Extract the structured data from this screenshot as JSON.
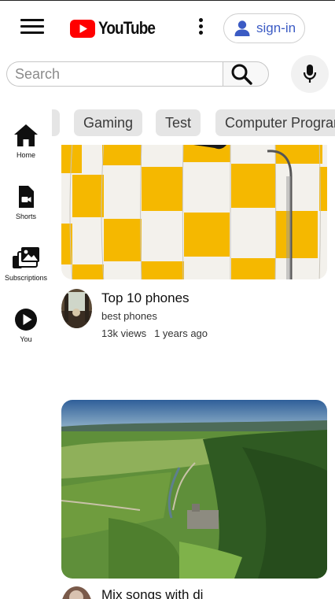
{
  "header": {
    "logo_text": "YouTube",
    "signin_label": "sign-in"
  },
  "search": {
    "placeholder": "Search",
    "value": ""
  },
  "sidebar": {
    "items": [
      {
        "label": "Home",
        "icon": "home-icon"
      },
      {
        "label": "Shorts",
        "icon": "shorts-icon"
      },
      {
        "label": "Subscriptions",
        "icon": "subscriptions-icon"
      },
      {
        "label": "You",
        "icon": "you-icon"
      }
    ]
  },
  "chips": [
    {
      "label": ""
    },
    {
      "label": "Gaming"
    },
    {
      "label": "Test"
    },
    {
      "label": "Computer Programming"
    }
  ],
  "videos": [
    {
      "title": "Top 10 phones",
      "channel": "best phones",
      "views": "13k views",
      "age": "1 years ago"
    },
    {
      "title": "Mix songs with dj"
    }
  ],
  "colors": {
    "brand_red": "#ff0000",
    "signin_text": "#3b5bc4",
    "chip_bg": "#e5e5e5"
  }
}
